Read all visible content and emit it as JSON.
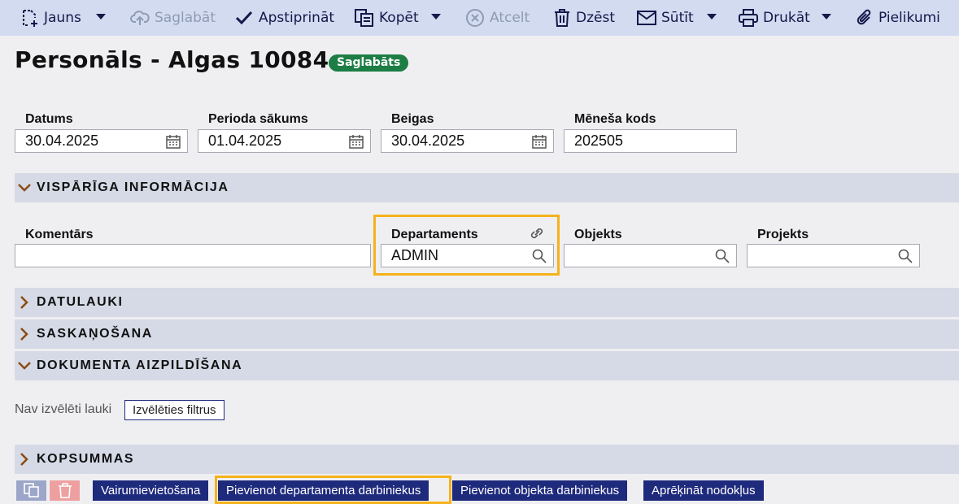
{
  "toolbar": {
    "new": "Jauns",
    "save": "Saglabāt",
    "approve": "Apstiprināt",
    "copy": "Kopēt",
    "cancel": "Atcelt",
    "delete": "Dzēst",
    "send": "Sūtīt",
    "print": "Drukāt",
    "attachments": "Pielikumi"
  },
  "header": {
    "title": "Personāls - Algas 10084",
    "status": "Saglabāts"
  },
  "fields": {
    "date": {
      "label": "Datums",
      "value": "30.04.2025"
    },
    "period_start": {
      "label": "Perioda sākums",
      "value": "01.04.2025"
    },
    "end": {
      "label": "Beigas",
      "value": "30.04.2025"
    },
    "month_code": {
      "label": "Mēneša kods",
      "value": "202505"
    },
    "comment": {
      "label": "Komentārs",
      "value": ""
    },
    "department": {
      "label": "Departaments",
      "value": "ADMIN"
    },
    "object": {
      "label": "Objekts",
      "value": ""
    },
    "project": {
      "label": "Projekts",
      "value": ""
    }
  },
  "sections": {
    "general": "VISPĀRĪGA INFORMĀCIJA",
    "date_fields": "DATULAUKI",
    "approval": "SASKAŅOŠANA",
    "doc_fill": "DOKUMENTA AIZPILDĪŠANA",
    "totals": "KOPSUMMAS"
  },
  "filters": {
    "none_text": "Nav izvēlēti lauki",
    "choose_button": "Izvēlēties filtrus"
  },
  "bottom_buttons": {
    "multi": "Vairumievietošana",
    "add_dept": "Pievienot departamenta darbiniekus",
    "add_obj": "Pievienot objekta darbiniekus",
    "calc_tax": "Aprēķināt nodokļus"
  },
  "colors": {
    "toolbar_bg": "#d2dbf0",
    "badge": "#1c7d45",
    "highlight": "#f6b21b",
    "button": "#1e2a7c",
    "section_bg": "#d5dae6"
  }
}
